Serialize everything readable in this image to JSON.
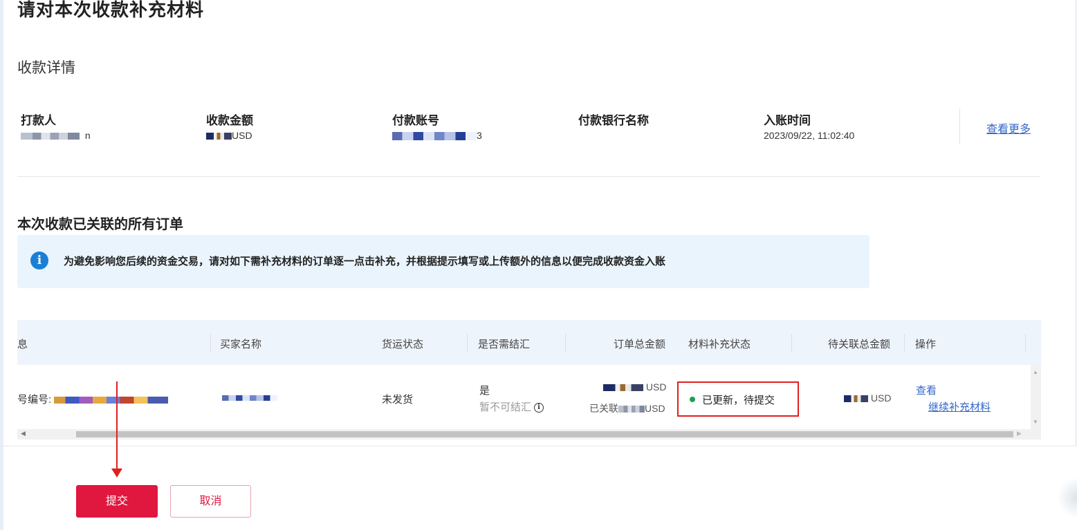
{
  "page": {
    "title": "请对本次收款补充材料"
  },
  "receipt_details": {
    "section_title": "收款详情",
    "fields": [
      {
        "label": "打款人",
        "value": "n"
      },
      {
        "label": "收款金额",
        "value": "USD"
      },
      {
        "label": "付款账号",
        "value": "3"
      },
      {
        "label": "付款银行名称",
        "value": ""
      },
      {
        "label": "入账时间",
        "value": "2023/09/22, 11:02:40"
      }
    ],
    "view_more_label": "查看更多"
  },
  "orders": {
    "section_title": "本次收款已关联的所有订单",
    "notice": "为避免影响您后续的资金交易，请对如下需补充材料的订单逐一点击补充，并根据提示填写或上传额外的信息以便完成收款资金入账",
    "notice_icon": "info-icon",
    "columns": [
      "息",
      "买家名称",
      "货运状态",
      "是否需结汇",
      "订单总金额",
      "材料补充状态",
      "待关联总金额",
      "操作"
    ],
    "rows": [
      {
        "order_info_label": "号编号:",
        "buyer": "",
        "shipping_status": "未发货",
        "need_settlement": "是",
        "settlement_note": "暂不可结汇",
        "total_amount": "USD",
        "linked_prefix": "已关联",
        "linked_amount": "USD",
        "material_status": "已更新，待提交",
        "pending_amount": "USD",
        "action_view": "查看",
        "action_continue": "继续补充材料"
      }
    ]
  },
  "footer": {
    "submit_label": "提交",
    "cancel_label": "取消"
  },
  "colors": {
    "primary": "#e0173f",
    "link": "#3366cc",
    "status_success": "#1aa34a",
    "highlight_box": "#e02020",
    "notice_bg": "#eaf4fc"
  }
}
